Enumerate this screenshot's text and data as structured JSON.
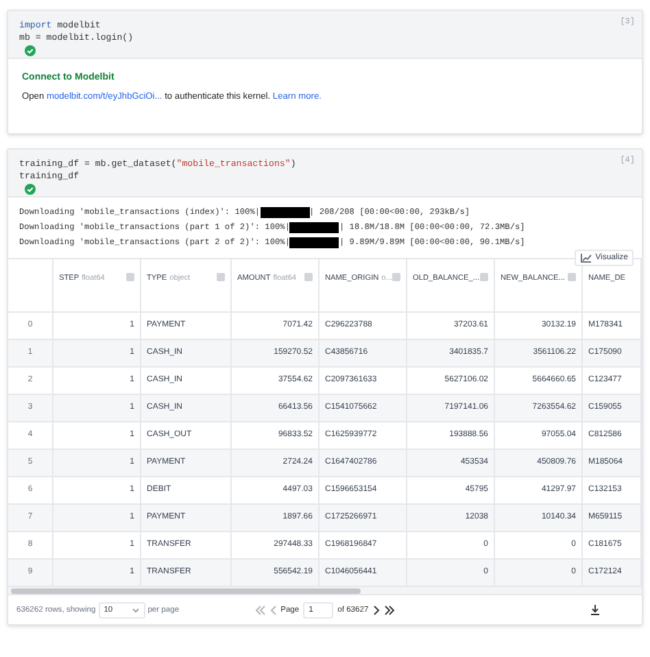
{
  "cells": [
    {
      "number": "[3]",
      "code": [
        [
          {
            "text": "import",
            "kind": "keyword"
          },
          {
            "text": " modelbit",
            "kind": "plain"
          }
        ],
        [
          {
            "text": "mb = modelbit.login()",
            "kind": "plain"
          }
        ]
      ],
      "output": {
        "kind": "connect",
        "title": "Connect to Modelbit",
        "parts": [
          {
            "text": "Open ",
            "kind": "plain"
          },
          {
            "text": "modelbit.com/t/eyJhbGciOi...",
            "kind": "link"
          },
          {
            "text": " to authenticate this kernel. ",
            "kind": "plain"
          },
          {
            "text": "Learn more.",
            "kind": "link"
          }
        ]
      }
    },
    {
      "number": "[4]",
      "code": [
        [
          {
            "text": "training_df = mb.get_dataset(",
            "kind": "plain"
          },
          {
            "text": "\"mobile_transactions\"",
            "kind": "string"
          },
          {
            "text": ")",
            "kind": "plain"
          }
        ],
        [
          {
            "text": "training_df",
            "kind": "plain"
          }
        ]
      ],
      "output": {
        "kind": "dataframe",
        "progress": [
          {
            "prefix": "Downloading 'mobile_transactions (index)': 100%|",
            "level": 1,
            "suffix": "| 208/208 [00:00<00:00, 293kB/s]"
          },
          {
            "prefix": "Downloading 'mobile_transactions (part 1 of 2)': 100%|",
            "level": 1,
            "suffix": "| 18.8M/18.8M [00:00<00:00, 72.3MB/s]"
          },
          {
            "prefix": "Downloading 'mobile_transactions (part 2 of 2)': 100%|",
            "level": 1,
            "suffix": "| 9.89M/9.89M [00:00<00:00, 90.1MB/s]"
          }
        ],
        "visualize": "Visualize",
        "table": {
          "columns": [
            {
              "name": "STEP",
              "dtype": "float64",
              "kind": "number"
            },
            {
              "name": "TYPE",
              "dtype": "object",
              "kind": "text"
            },
            {
              "name": "AMOUNT",
              "dtype": "float64",
              "kind": "number"
            },
            {
              "name": "NAME_ORIGIN",
              "dtype": "o...",
              "kind": "text"
            },
            {
              "name": "OLD_BALANCE_...",
              "kind": "number"
            },
            {
              "name": "NEW_BALANCE...",
              "kind": "number"
            },
            {
              "name": "NAME_DE",
              "kind": "text"
            }
          ],
          "rows": [
            {
              "index": "0",
              "cells": [
                "1",
                "PAYMENT",
                "7071.42",
                "C296223788",
                "37203.61",
                "30132.19",
                "M178341"
              ]
            },
            {
              "index": "1",
              "cells": [
                "1",
                "CASH_IN",
                "159270.52",
                "C43856716",
                "3401835.7",
                "3561106.22",
                "C175090"
              ]
            },
            {
              "index": "2",
              "cells": [
                "1",
                "CASH_IN",
                "37554.62",
                "C2097361633",
                "5627106.02",
                "5664660.65",
                "C123477"
              ]
            },
            {
              "index": "3",
              "cells": [
                "1",
                "CASH_IN",
                "66413.56",
                "C1541075662",
                "7197141.06",
                "7263554.62",
                "C159055"
              ]
            },
            {
              "index": "4",
              "cells": [
                "1",
                "CASH_OUT",
                "96833.52",
                "C1625939772",
                "193888.56",
                "97055.04",
                "C812586"
              ]
            },
            {
              "index": "5",
              "cells": [
                "1",
                "PAYMENT",
                "2724.24",
                "C1647402786",
                "453534",
                "450809.76",
                "M185064"
              ]
            },
            {
              "index": "6",
              "cells": [
                "1",
                "DEBIT",
                "4497.03",
                "C1596653154",
                "45795",
                "41297.97",
                "C132153"
              ]
            },
            {
              "index": "7",
              "cells": [
                "1",
                "PAYMENT",
                "1897.66",
                "C1725266971",
                "12038",
                "10140.34",
                "M659115"
              ]
            },
            {
              "index": "8",
              "cells": [
                "1",
                "TRANSFER",
                "297448.33",
                "C1968196847",
                "0",
                "0",
                "C181675"
              ]
            },
            {
              "index": "9",
              "cells": [
                "1",
                "TRANSFER",
                "556542.19",
                "C1046056441",
                "0",
                "0",
                "C172124"
              ]
            }
          ]
        },
        "footer": {
          "rows_text": "636262 rows, showing",
          "page_size": "10",
          "per_page": "per page",
          "page_label": "Page",
          "page": "1",
          "of_pages": "of 63627"
        }
      }
    }
  ]
}
